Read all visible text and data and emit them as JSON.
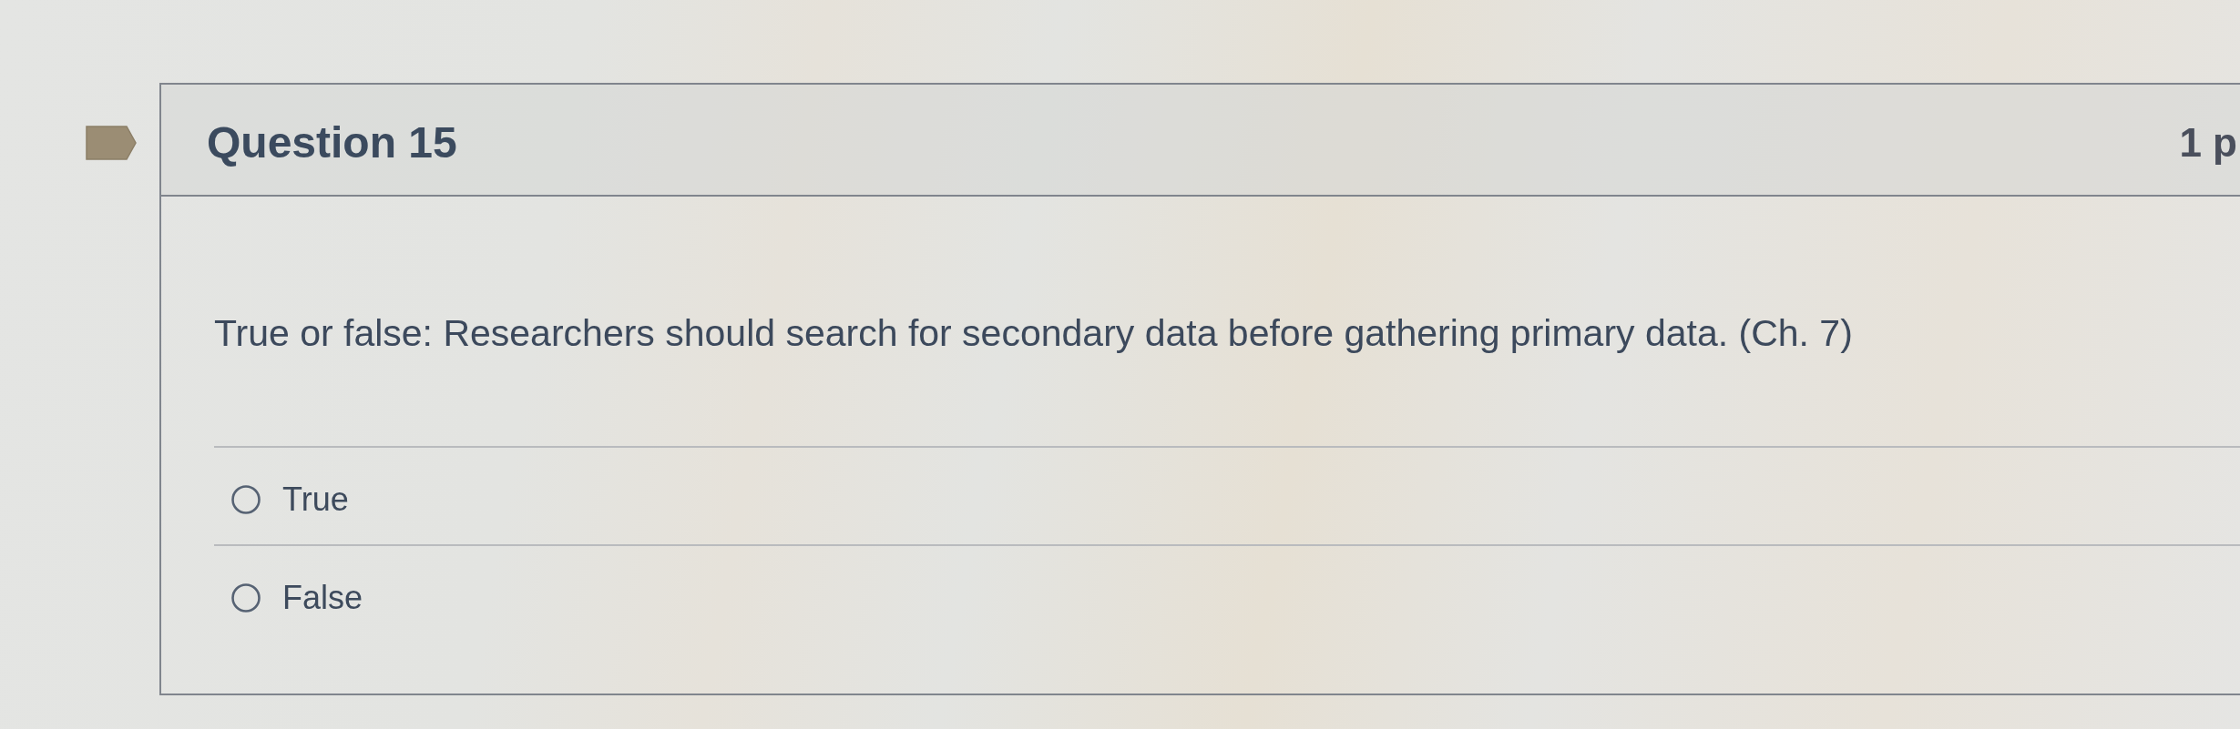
{
  "question": {
    "title": "Question 15",
    "points": "1 p",
    "prompt": "True or false: Researchers should search for secondary data before gathering primary data. (Ch. 7)",
    "answers": [
      {
        "label": "True",
        "selected": false
      },
      {
        "label": "False",
        "selected": false
      }
    ]
  }
}
